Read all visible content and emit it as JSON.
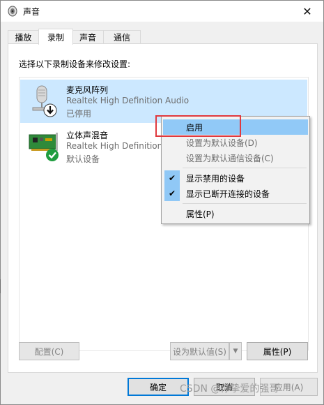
{
  "window": {
    "title": "声音",
    "close_glyph": "✕"
  },
  "tabs": [
    {
      "label": "播放",
      "active": false
    },
    {
      "label": "录制",
      "active": true
    },
    {
      "label": "声音",
      "active": false
    },
    {
      "label": "通信",
      "active": false
    }
  ],
  "instruction": "选择以下录制设备来修改设置:",
  "devices": [
    {
      "name": "麦克风阵列",
      "driver": "Realtek High Definition Audio",
      "status": "已停用",
      "icon": "microphone-icon",
      "badge": "down-arrow-badge-icon",
      "selected": true
    },
    {
      "name": "立体声混音",
      "driver": "Realtek High Definition Audio",
      "status": "默认设备",
      "icon": "sound-card-icon",
      "badge": "green-check-badge-icon",
      "selected": false
    }
  ],
  "context_menu": {
    "items": [
      {
        "label": "启用",
        "highlighted": true,
        "disabled": false,
        "checked": false
      },
      {
        "label": "设置为默认设备(D)",
        "highlighted": false,
        "disabled": true,
        "checked": false
      },
      {
        "label": "设置为默认通信设备(C)",
        "highlighted": false,
        "disabled": true,
        "checked": false
      },
      {
        "label": "显示禁用的设备",
        "highlighted": false,
        "disabled": false,
        "checked": true
      },
      {
        "label": "显示已断开连接的设备",
        "highlighted": false,
        "disabled": false,
        "checked": true
      },
      {
        "label": "属性(P)",
        "highlighted": false,
        "disabled": false,
        "checked": false
      }
    ],
    "check_glyph": "✔"
  },
  "buttons": {
    "configure": "配置(C)",
    "set_default": "设为默认值(S)",
    "properties": "属性(P)",
    "ok": "确定",
    "cancel": "取消",
    "apply": "应用(A)"
  },
  "watermark": "CSDN @你挚爱的强哥",
  "colors": {
    "selection": "#cce8ff",
    "menu_highlight": "#91c9f7",
    "annotation_box": "#e0393e",
    "accent": "#0078d7"
  }
}
